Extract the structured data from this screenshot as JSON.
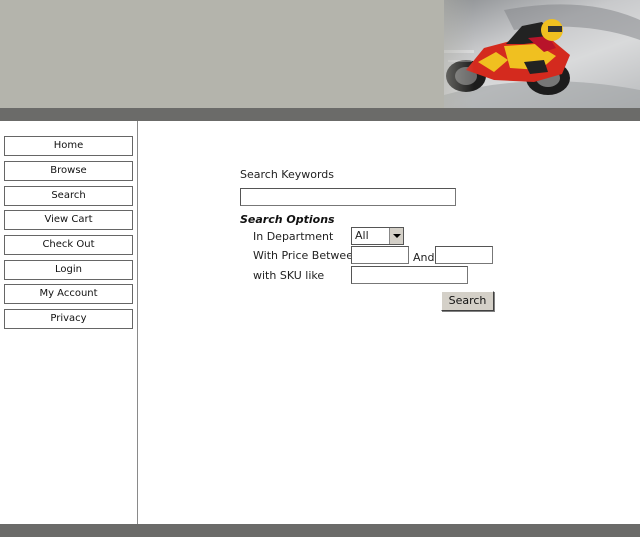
{
  "nav": {
    "items": [
      {
        "label": "Home"
      },
      {
        "label": "Browse"
      },
      {
        "label": "Search"
      },
      {
        "label": "View Cart"
      },
      {
        "label": "Check Out"
      },
      {
        "label": "Login"
      },
      {
        "label": "My Account"
      },
      {
        "label": "Privacy"
      }
    ]
  },
  "search": {
    "keywords_label": "Search Keywords",
    "keywords_value": "",
    "options_title": "Search Options",
    "department_label": "In Department",
    "department_selected": "All",
    "price_label": "With Price Between",
    "price_min": "",
    "price_and": "And",
    "price_max": "",
    "sku_label": "with SKU like",
    "sku_value": "",
    "button_label": "Search"
  },
  "colors": {
    "header_bg": "#b4b4ac",
    "bar": "#6b6b69",
    "bike_red": "#d42a1e",
    "bike_yellow": "#f0c020"
  }
}
